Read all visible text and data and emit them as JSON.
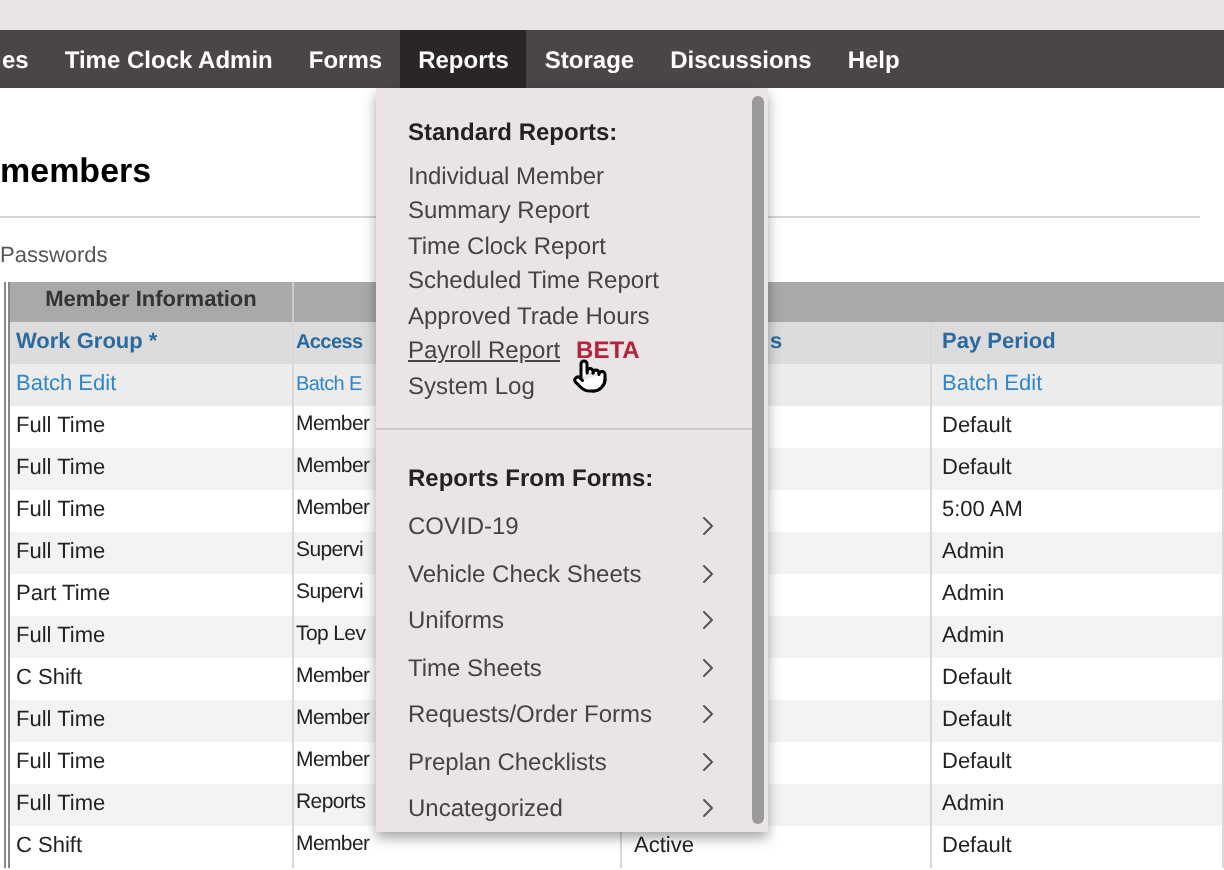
{
  "nav": [
    {
      "label": "es",
      "selected": false
    },
    {
      "label": "Time Clock Admin",
      "selected": false
    },
    {
      "label": "Forms",
      "selected": false
    },
    {
      "label": "Reports",
      "selected": true
    },
    {
      "label": "Storage",
      "selected": false
    },
    {
      "label": "Discussions",
      "selected": false
    },
    {
      "label": "Help",
      "selected": false
    }
  ],
  "page": {
    "title": "members",
    "subtitle": "Passwords"
  },
  "table": {
    "group_header": "Member Information",
    "columns": [
      {
        "label": "Work Group *"
      },
      {
        "label": "Access"
      },
      {
        "label": "s"
      },
      {
        "label": "Pay Period"
      }
    ],
    "batch_row": {
      "work_group": "Batch Edit",
      "access": "Batch E",
      "pay_period": "Batch Edit"
    },
    "rows": [
      {
        "work_group": "Full Time",
        "access": "Member",
        "pay_period": "Default"
      },
      {
        "work_group": "Full Time",
        "access": "Member",
        "pay_period": "Default"
      },
      {
        "work_group": "Full Time",
        "access": "Member",
        "pay_period": "5:00 AM"
      },
      {
        "work_group": "Full Time",
        "access": "Supervi",
        "pay_period": "Admin"
      },
      {
        "work_group": "Part Time",
        "access": "Supervi",
        "pay_period": "Admin"
      },
      {
        "work_group": "Full Time",
        "access": "Top Lev",
        "pay_period": "Admin"
      },
      {
        "work_group": "C Shift",
        "access": "Member",
        "pay_period": "Default"
      },
      {
        "work_group": "Full Time",
        "access": "Member",
        "pay_period": "Default"
      },
      {
        "work_group": "Full Time",
        "access": "Member",
        "pay_period": "Default"
      },
      {
        "work_group": "Full Time",
        "access": "Reports",
        "pay_period": "Admin"
      },
      {
        "work_group": "C Shift",
        "access": "Member",
        "column_3": "Active",
        "pay_period": "Default"
      }
    ]
  },
  "menu": {
    "sections": [
      {
        "heading": "Standard Reports:",
        "items": [
          {
            "label": "Individual Member",
            "kind": "link",
            "hovered": false
          },
          {
            "label": "Summary Report",
            "kind": "link",
            "hovered": false
          },
          {
            "label": "Time Clock Report",
            "kind": "link",
            "hovered": false
          },
          {
            "label": "Scheduled Time Report",
            "kind": "link",
            "hovered": false
          },
          {
            "label": "Approved Trade Hours",
            "kind": "link",
            "hovered": false
          },
          {
            "label": "Payroll Report",
            "badge": "BETA",
            "kind": "link",
            "hovered": true
          },
          {
            "label": "System Log",
            "kind": "link",
            "hovered": false
          }
        ]
      },
      {
        "heading": "Reports From Forms:",
        "items": [
          {
            "label": "COVID-19",
            "kind": "submenu"
          },
          {
            "label": "Vehicle Check Sheets",
            "kind": "submenu"
          },
          {
            "label": "Uniforms",
            "kind": "submenu"
          },
          {
            "label": "Time Sheets",
            "kind": "submenu"
          },
          {
            "label": "Requests/Order Forms",
            "kind": "submenu"
          },
          {
            "label": "Preplan Checklists",
            "kind": "submenu"
          },
          {
            "label": "Uncategorized",
            "kind": "submenu"
          }
        ]
      }
    ]
  }
}
